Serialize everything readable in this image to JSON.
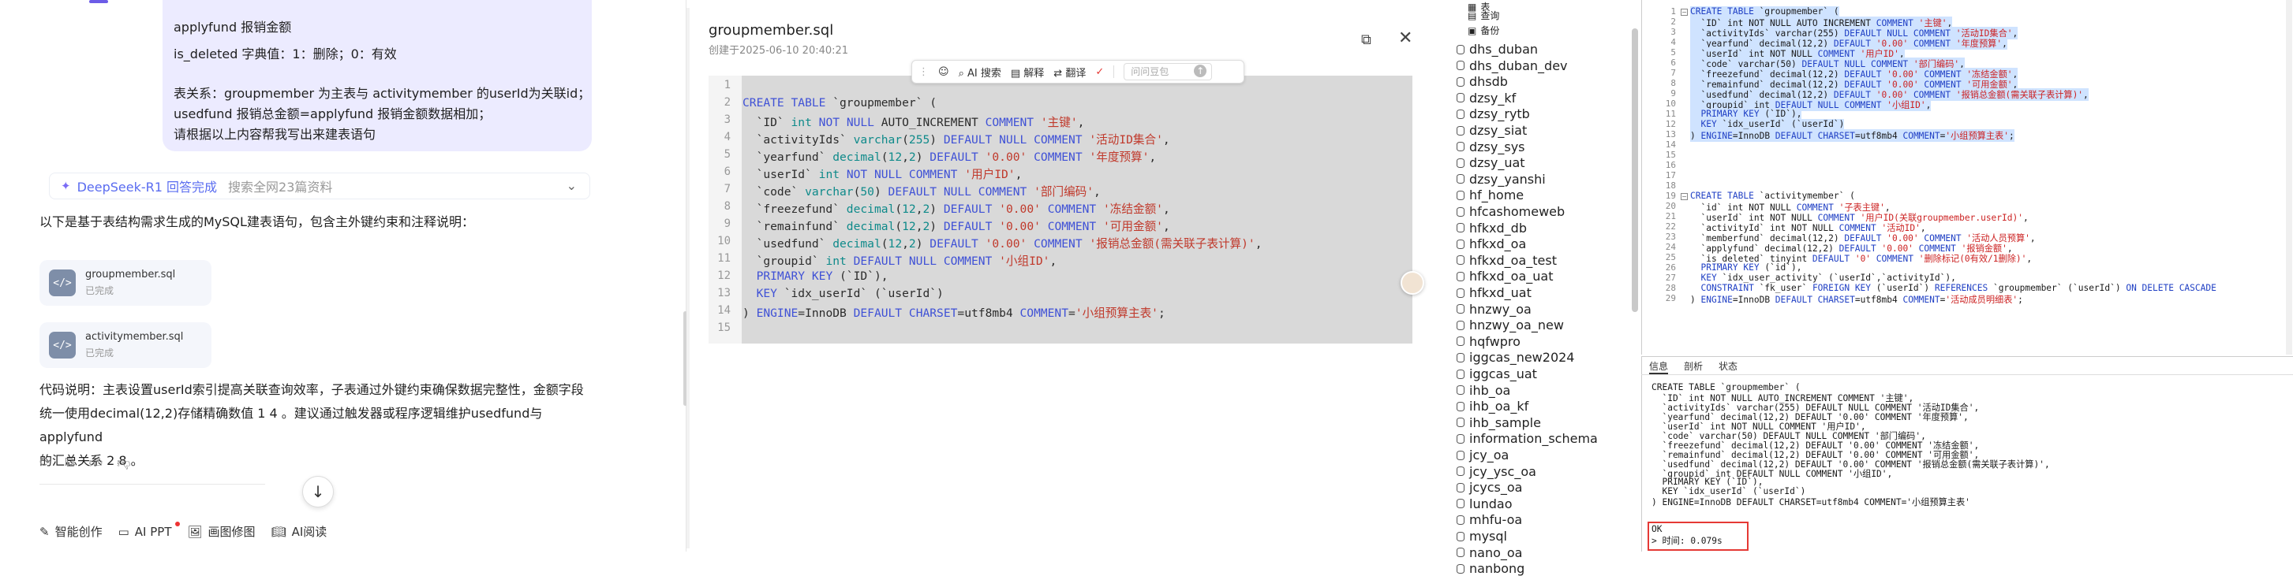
{
  "chat": {
    "bubble_lines": [
      "applyfund  报销金额",
      "is_deleted          字典值：1：删除；0：有效",
      "",
      "表关系：groupmember 为主表与 activitymember  的userId为关联id；",
      "usedfund 报销总金额=applyfund 报销金额数据相加；",
      "请根据以上内容帮我写出来建表语句"
    ],
    "deepseek_label": "DeepSeek-R1 回答完成",
    "search_label": "搜索全网23篇资料",
    "intro": "以下是基于表结构需求生成的MySQL建表语句，包含主外键约束和注释说明：",
    "files": [
      {
        "name": "groupmember.sql",
        "status": "已完成"
      },
      {
        "name": "activitymember.sql",
        "status": "已完成"
      }
    ],
    "explain_lines": [
      "代码说明：主表设置userId索引提高关联查询效率，子表通过外键约束确保数据完整性，金额字段",
      "统一使用decimal(12,2)存储精确数值 1 4 。建议通过触发器或程序逻辑维护usedfund与applyfund",
      "的汇总关系 2 8 。"
    ],
    "tools": [
      "智能创作",
      "AI PPT",
      "画图修图",
      "AI阅读"
    ]
  },
  "viewer": {
    "title": "groupmember.sql",
    "created": "创建于2025-06-10 20:40:21",
    "popbar": {
      "ai_search": "AI 搜索",
      "explain": "解释",
      "translate": "翻译",
      "ask_placeholder": "问问豆包"
    },
    "line_numbers": [
      "1",
      "2",
      "3",
      "4",
      "5",
      "6",
      "7",
      "8",
      "9",
      "10",
      "11",
      "12",
      "13",
      "14",
      "15"
    ]
  },
  "dbtree": {
    "top_items": [
      "表",
      "查询",
      "备份"
    ],
    "databases": [
      "dhs_duban",
      "dhs_duban_dev",
      "dhsdb",
      "dzsy_kf",
      "dzsy_rytb",
      "dzsy_siat",
      "dzsy_sys",
      "dzsy_uat",
      "dzsy_yanshi",
      "hf_home",
      "hfcashomeweb",
      "hfkxd_db",
      "hfkxd_oa",
      "hfkxd_oa_test",
      "hfkxd_oa_uat",
      "hfkxd_uat",
      "hnzwy_oa",
      "hnzwy_oa_new",
      "hqfwpro",
      "iggcas_new2024",
      "iggcas_uat",
      "ihb_oa",
      "ihb_oa_kf",
      "ihb_sample",
      "information_schema",
      "jcy_oa",
      "jcy_ysc_oa",
      "jcycs_oa",
      "lundao",
      "mhfu-oa",
      "mysql",
      "nano_oa",
      "nanbong"
    ]
  },
  "result": {
    "tabs": [
      "信息",
      "剖析",
      "状态"
    ],
    "ok": "OK",
    "time": "> 时间: 0.079s"
  },
  "colors": {
    "accent": "#6c5ce7",
    "bubble": "#ecebff",
    "highlight_box": "#e53935"
  }
}
